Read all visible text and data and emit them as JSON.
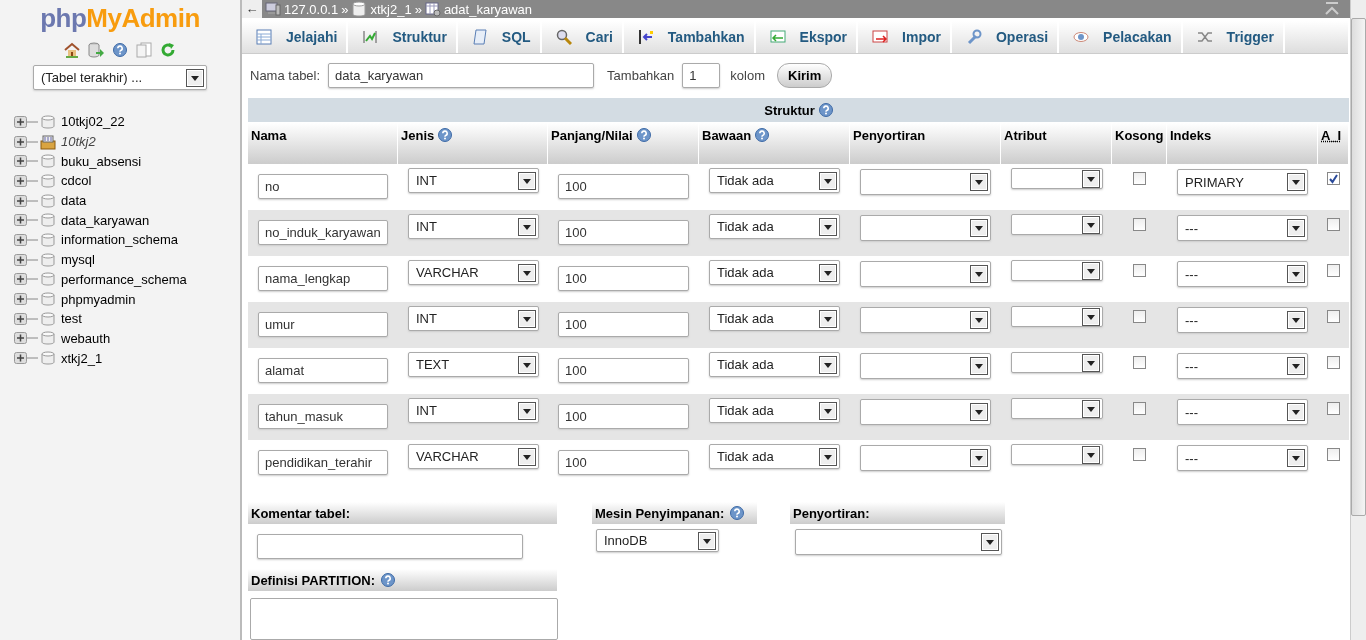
{
  "sidebar": {
    "logo": {
      "prefix": "php",
      "name": "MyAdmin"
    },
    "recent_tables": "(Tabel terakhir) ...",
    "databases": [
      {
        "name": "10tkj02_22",
        "current": false
      },
      {
        "name": "10tkj2",
        "current": true
      },
      {
        "name": "buku_absensi",
        "current": false
      },
      {
        "name": "cdcol",
        "current": false
      },
      {
        "name": "data",
        "current": false
      },
      {
        "name": "data_karyawan",
        "current": false
      },
      {
        "name": "information_schema",
        "current": false
      },
      {
        "name": "mysql",
        "current": false
      },
      {
        "name": "performance_schema",
        "current": false
      },
      {
        "name": "phpmyadmin",
        "current": false
      },
      {
        "name": "test",
        "current": false
      },
      {
        "name": "webauth",
        "current": false
      },
      {
        "name": "xtkj2_1",
        "current": false
      }
    ]
  },
  "breadcrumb": {
    "back": "←",
    "separator": "»",
    "items": [
      "127.0.0.1",
      "xtkj2_1",
      "adat_karyawan"
    ]
  },
  "tabs": [
    {
      "label": "Jelajahi",
      "selected": false
    },
    {
      "label": "Struktur",
      "selected": false
    },
    {
      "label": "SQL",
      "selected": false
    },
    {
      "label": "Cari",
      "selected": false
    },
    {
      "label": "Tambahkan",
      "selected": false
    },
    {
      "label": "Ekspor",
      "selected": false
    },
    {
      "label": "Impor",
      "selected": false
    },
    {
      "label": "Operasi",
      "selected": false
    },
    {
      "label": "Pelacakan",
      "selected": false
    },
    {
      "label": "Trigger",
      "selected": false
    }
  ],
  "form": {
    "name_label": "Nama tabel:",
    "table_name": "data_karyawan",
    "add_label": "Tambahkan",
    "add_count": "1",
    "column_label": "kolom",
    "submit": "Kirim"
  },
  "table": {
    "section": "Struktur",
    "columns": [
      {
        "label": "Nama",
        "help": false
      },
      {
        "label": "Jenis",
        "help": true
      },
      {
        "label": "Panjang/Nilai",
        "help": true
      },
      {
        "label": "Bawaan",
        "help": true
      },
      {
        "label": "Penyortiran",
        "help": false
      },
      {
        "label": "Atribut",
        "help": false
      },
      {
        "label": "Kosong",
        "help": false
      },
      {
        "label": "Indeks",
        "help": false
      },
      {
        "label": "A_I",
        "help": false
      }
    ],
    "rows": [
      {
        "name": "no",
        "type": "INT",
        "length": "100",
        "default": "Tidak ada",
        "index": "PRIMARY",
        "null": false,
        "auto_increment": true
      },
      {
        "name": "no_induk_karyawan",
        "type": "INT",
        "length": "100",
        "default": "Tidak ada",
        "index": "---",
        "null": false,
        "auto_increment": false
      },
      {
        "name": "nama_lengkap",
        "type": "VARCHAR",
        "length": "100",
        "default": "Tidak ada",
        "index": "---",
        "null": false,
        "auto_increment": false
      },
      {
        "name": "umur",
        "type": "INT",
        "length": "100",
        "default": "Tidak ada",
        "index": "---",
        "null": false,
        "auto_increment": false
      },
      {
        "name": "alamat",
        "type": "TEXT",
        "length": "100",
        "default": "Tidak ada",
        "index": "---",
        "null": false,
        "auto_increment": false
      },
      {
        "name": "tahun_masuk",
        "type": "INT",
        "length": "100",
        "default": "Tidak ada",
        "index": "---",
        "null": false,
        "auto_increment": false
      },
      {
        "name": "pendidikan_terahir",
        "type": "VARCHAR",
        "length": "100",
        "default": "Tidak ada",
        "index": "---",
        "null": false,
        "auto_increment": false
      }
    ]
  },
  "options": {
    "comment_label": "Komentar tabel:",
    "engine_label": "Mesin Penyimpanan:",
    "engine": "InnoDB",
    "collation_label": "Penyortiran:",
    "partition_label": "Definisi PARTITION:"
  }
}
